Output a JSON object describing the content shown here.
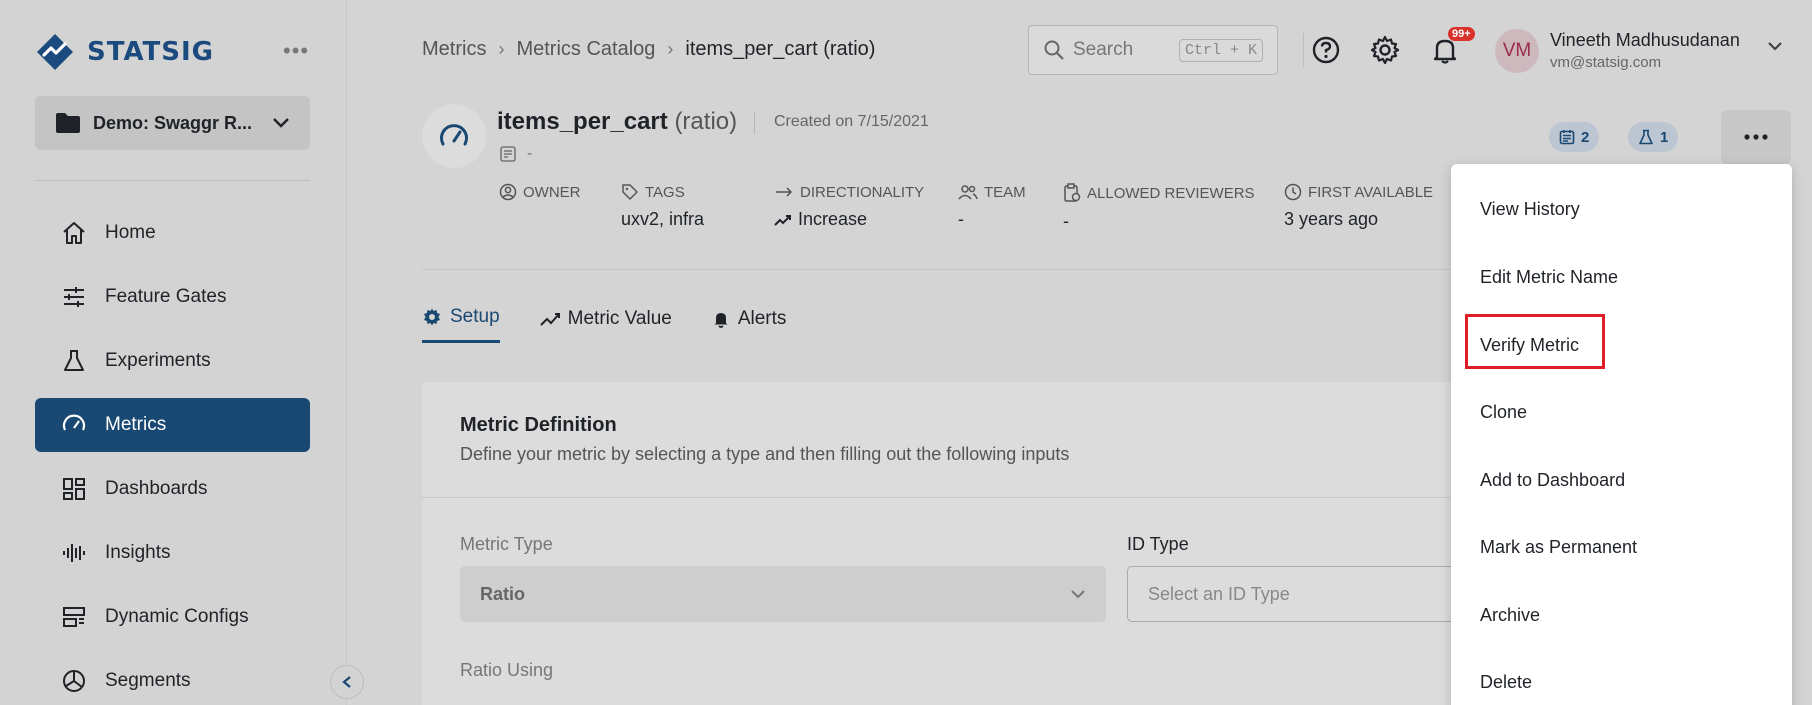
{
  "sidebar": {
    "logo_text": "STATSIG",
    "more_icon": "more-horizontal-icon",
    "project": "Demo: Swaggr R...",
    "items": [
      {
        "label": "Home",
        "icon": "home-icon",
        "active": false
      },
      {
        "label": "Feature Gates",
        "icon": "sliders-icon",
        "active": false
      },
      {
        "label": "Experiments",
        "icon": "flask-icon",
        "active": false
      },
      {
        "label": "Metrics",
        "icon": "gauge-icon",
        "active": true
      },
      {
        "label": "Dashboards",
        "icon": "dashboard-icon",
        "active": false
      },
      {
        "label": "Insights",
        "icon": "waveform-icon",
        "active": false
      },
      {
        "label": "Dynamic Configs",
        "icon": "config-icon",
        "active": false
      },
      {
        "label": "Segments",
        "icon": "pie-icon",
        "active": false
      }
    ]
  },
  "header": {
    "breadcrumb": [
      "Metrics",
      "Metrics Catalog",
      "items_per_cart (ratio)"
    ],
    "search_placeholder": "Search",
    "search_shortcut": "Ctrl + K",
    "notification_count": "99+",
    "user_initials": "VM",
    "user_name": "Vineeth Madhusudanan",
    "user_email": "vm@statsig.com"
  },
  "metric": {
    "name": "items_per_cart",
    "kind": "(ratio)",
    "created": "Created on 7/15/2021",
    "note": "-",
    "meta": [
      {
        "label": "OWNER",
        "value": "",
        "icon": "user-circle-icon"
      },
      {
        "label": "TAGS",
        "value": "uxv2, infra",
        "icon": "tag-icon"
      },
      {
        "label": "DIRECTIONALITY",
        "value": "Increase",
        "icon": "arrow-right-icon"
      },
      {
        "label": "TEAM",
        "value": "-",
        "icon": "team-icon"
      },
      {
        "label": "ALLOWED REVIEWERS",
        "value": "-",
        "icon": "clipboard-icon"
      },
      {
        "label": "FIRST AVAILABLE",
        "value": "3 years ago",
        "icon": "clock-icon"
      }
    ],
    "badge_dashboards": "2",
    "badge_experiments": "1"
  },
  "tabs": [
    {
      "label": "Setup",
      "icon": "gear-icon",
      "active": true
    },
    {
      "label": "Metric Value",
      "icon": "trend-icon",
      "active": false
    },
    {
      "label": "Alerts",
      "icon": "bell-icon",
      "active": false
    }
  ],
  "card": {
    "title": "Metric Definition",
    "description": "Define your metric by selecting a type and then filling out the following inputs",
    "metric_type_label": "Metric Type",
    "metric_type_value": "Ratio",
    "id_type_label": "ID Type",
    "id_type_placeholder": "Select an ID Type",
    "ratio_using_label": "Ratio Using"
  },
  "menu": {
    "items": [
      "View History",
      "Edit Metric Name",
      "Verify Metric",
      "Clone",
      "Add to Dashboard",
      "Mark as Permanent",
      "Archive",
      "Delete"
    ],
    "highlighted": "Verify Metric"
  },
  "colors": {
    "brand": "#194873",
    "highlight": "#e01e26",
    "badge": "#d9322d"
  }
}
